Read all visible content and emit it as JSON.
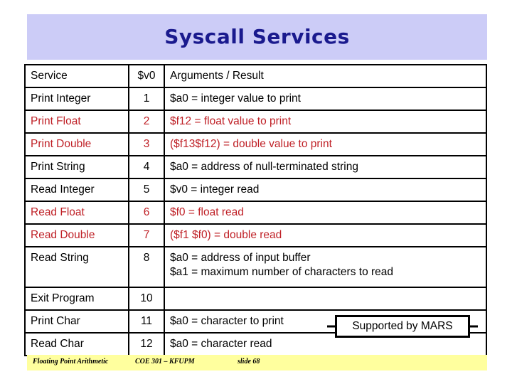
{
  "slide": {
    "title": "Syscall Services",
    "title_bg_color": "#ccccf7",
    "title_text_color": "#1a1a8e",
    "accent_red": "#bf2026",
    "footer_bg_color": "#ffff9e"
  },
  "table": {
    "headers": {
      "service": "Service",
      "v0": "$v0",
      "args": "Arguments / Result"
    },
    "rows": [
      {
        "service": "Print Integer",
        "v0": "1",
        "args": [
          "$a0 = integer value to print"
        ],
        "red": false
      },
      {
        "service": "Print Float",
        "v0": "2",
        "args": [
          "$f12 =  float value to print"
        ],
        "red": true
      },
      {
        "service": "Print Double",
        "v0": "3",
        "args": [
          "($f13$f12) = double value to print"
        ],
        "red": true
      },
      {
        "service": "Print String",
        "v0": "4",
        "args": [
          "$a0 = address of null-terminated string"
        ],
        "red": false
      },
      {
        "service": "Read Integer",
        "v0": "5",
        "args": [
          "$v0 = integer read"
        ],
        "red": false
      },
      {
        "service": "Read Float",
        "v0": "6",
        "args": [
          "$f0 = float read"
        ],
        "red": true
      },
      {
        "service": "Read Double",
        "v0": "7",
        "args": [
          "($f1 $f0) = double read"
        ],
        "red": true
      },
      {
        "service": "Read String",
        "v0": "8",
        "args": [
          "$a0 = address of input buffer",
          "$a1 = maximum number of characters to read"
        ],
        "red": false
      },
      {
        "service": "Exit Program",
        "v0": "10",
        "args": [
          ""
        ],
        "red": false
      },
      {
        "service": "Print Char",
        "v0": "11",
        "args": [
          "$a0 = character to print"
        ],
        "red": false
      },
      {
        "service": "Read Char",
        "v0": "12",
        "args": [
          "$a0 = character read"
        ],
        "red": false
      }
    ]
  },
  "callout": {
    "label": "Supported by MARS"
  },
  "footer": {
    "left": "Floating Point Arithmetic",
    "center": "COE 301 – KFUPM",
    "right": "slide 68"
  }
}
